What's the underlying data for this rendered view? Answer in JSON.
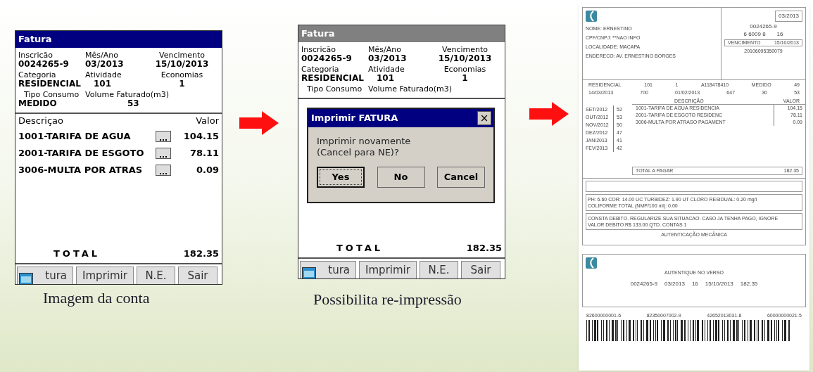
{
  "screens": [
    {
      "caption": "Imagem da conta",
      "title": "Fatura",
      "title_active": true,
      "fields": [
        {
          "label": "Inscricão",
          "value": "0024265-9"
        },
        {
          "label": "Mês/Ano",
          "value": "03/2013"
        },
        {
          "label": "Vencimento",
          "value": "15/10/2013"
        },
        {
          "label": "Categoria",
          "value": "RESIDENCIAL"
        },
        {
          "label": "Atividade",
          "value": "101"
        },
        {
          "label": "Economias",
          "value": "1"
        },
        {
          "label": "Tipo Consumo",
          "value": "MEDIDO"
        },
        {
          "label": "Volume Faturado(m3)",
          "value": "53"
        }
      ],
      "items_header": [
        "Descriçao",
        "Valor"
      ],
      "items": [
        {
          "description": "1001-TARIFA DE AGUA",
          "value": "104.15"
        },
        {
          "description": "2001-TARIFA DE ESGOTO",
          "value": "78.11"
        },
        {
          "description": "3006-MULTA POR ATRAS",
          "value": "0.09"
        }
      ],
      "total_label": "TOTAL",
      "total": "182.35",
      "buttons": [
        "tura",
        "Imprimir",
        "N.E.",
        "Sair"
      ]
    },
    {
      "caption": "Possibilita re-impressão",
      "title": "Fatura",
      "title_active": false,
      "fields": [
        {
          "label": "Inscricão",
          "value": "0024265-9"
        },
        {
          "label": "Mês/Ano",
          "value": "03/2013"
        },
        {
          "label": "Vencimento",
          "value": "15/10/2013"
        },
        {
          "label": "Categoria",
          "value": "RESIDENCIAL"
        },
        {
          "label": "Atividade",
          "value": "101"
        },
        {
          "label": "Economias",
          "value": "1"
        },
        {
          "label": "Tipo Consumo"
        },
        {
          "label": "Volume Faturado(m3)"
        }
      ],
      "dialog": {
        "title": "Imprimir FATURA",
        "close": "×",
        "message": [
          "Imprimir novamente",
          "(Cancel para NE)?"
        ],
        "buttons": [
          {
            "label": "Yes",
            "default": true
          },
          {
            "label": "No",
            "default": false
          },
          {
            "label": "Cancel",
            "default": false
          }
        ]
      },
      "total_label": "TOTAL",
      "total": "182.35",
      "buttons": [
        "tura",
        "Imprimir",
        "N.E.",
        "Sair"
      ]
    }
  ],
  "bill": {
    "period": "03/2013",
    "customer": [
      "NOME: ERNESTINO",
      "CPF/CNPJ: **NAO INFO",
      "LOCALIDADE: MACAPA",
      "ENDERECO: AV. ERNESTINO BORGES"
    ],
    "registration": "0024265-9",
    "route": [
      "6 6009 8",
      "16"
    ],
    "due_label": "VENCIMENTO",
    "due": "15/10/2013",
    "code": "20106095350079",
    "info_row_1": [
      "RESIDENCIAL",
      "101",
      "1",
      "A118478410",
      "MEDIDO",
      "49"
    ],
    "info_row_2": [
      "14/03/2013",
      "700",
      "01/02/2013",
      "647",
      "30",
      "53"
    ],
    "history": [
      {
        "month": "SET/2012",
        "value": "52"
      },
      {
        "month": "OUT/2012",
        "value": "53"
      },
      {
        "month": "NOV/2012",
        "value": "50"
      },
      {
        "month": "DEZ/2012",
        "value": "47"
      },
      {
        "month": "JAN/2013",
        "value": "41"
      },
      {
        "month": "FEV/2013",
        "value": "42"
      }
    ],
    "items_header": [
      "DESCRIÇÃO",
      "VALOR"
    ],
    "items": [
      {
        "description": "1001-TARIFA DE AGUA RESIDENCIA",
        "value": "104.15"
      },
      {
        "description": "2001-TARIFA DE ESGOTO RESIDENC",
        "value": "78.11"
      },
      {
        "description": "3006-MULTA POR ATRASO PAGAMENT",
        "value": "0.09"
      }
    ],
    "total_label": "TOTAL A PAGAR",
    "total": "182.35",
    "quality": [
      "PH: 6.60 COR: 14.00 UC TURBIDEZ: 1.90 UT CLORO RESIDUAL: 0.20 mg/l",
      "COLIFORME TOTAL (NMP/100 ml): 0.00"
    ],
    "notice": [
      "CONSTA DEBITO. REGULARIZE SUA SITUACAO. CASO JA TENHA PAGO, IGNORE",
      "VALOR DEBITO R$ 133.00 QTD. CONTAS 1"
    ],
    "authentication": "AUTENTICAÇÃO MECÂNICA",
    "stub": {
      "note": "AUTENTIQUE NO VERSO",
      "values": [
        "0024265-9",
        "03/2013",
        "16",
        "15/10/2013",
        "182.35"
      ]
    },
    "barcode_numbers": [
      "82600000001-6",
      "82350007002-9",
      "42652013031-8",
      "60000000021-5"
    ]
  }
}
